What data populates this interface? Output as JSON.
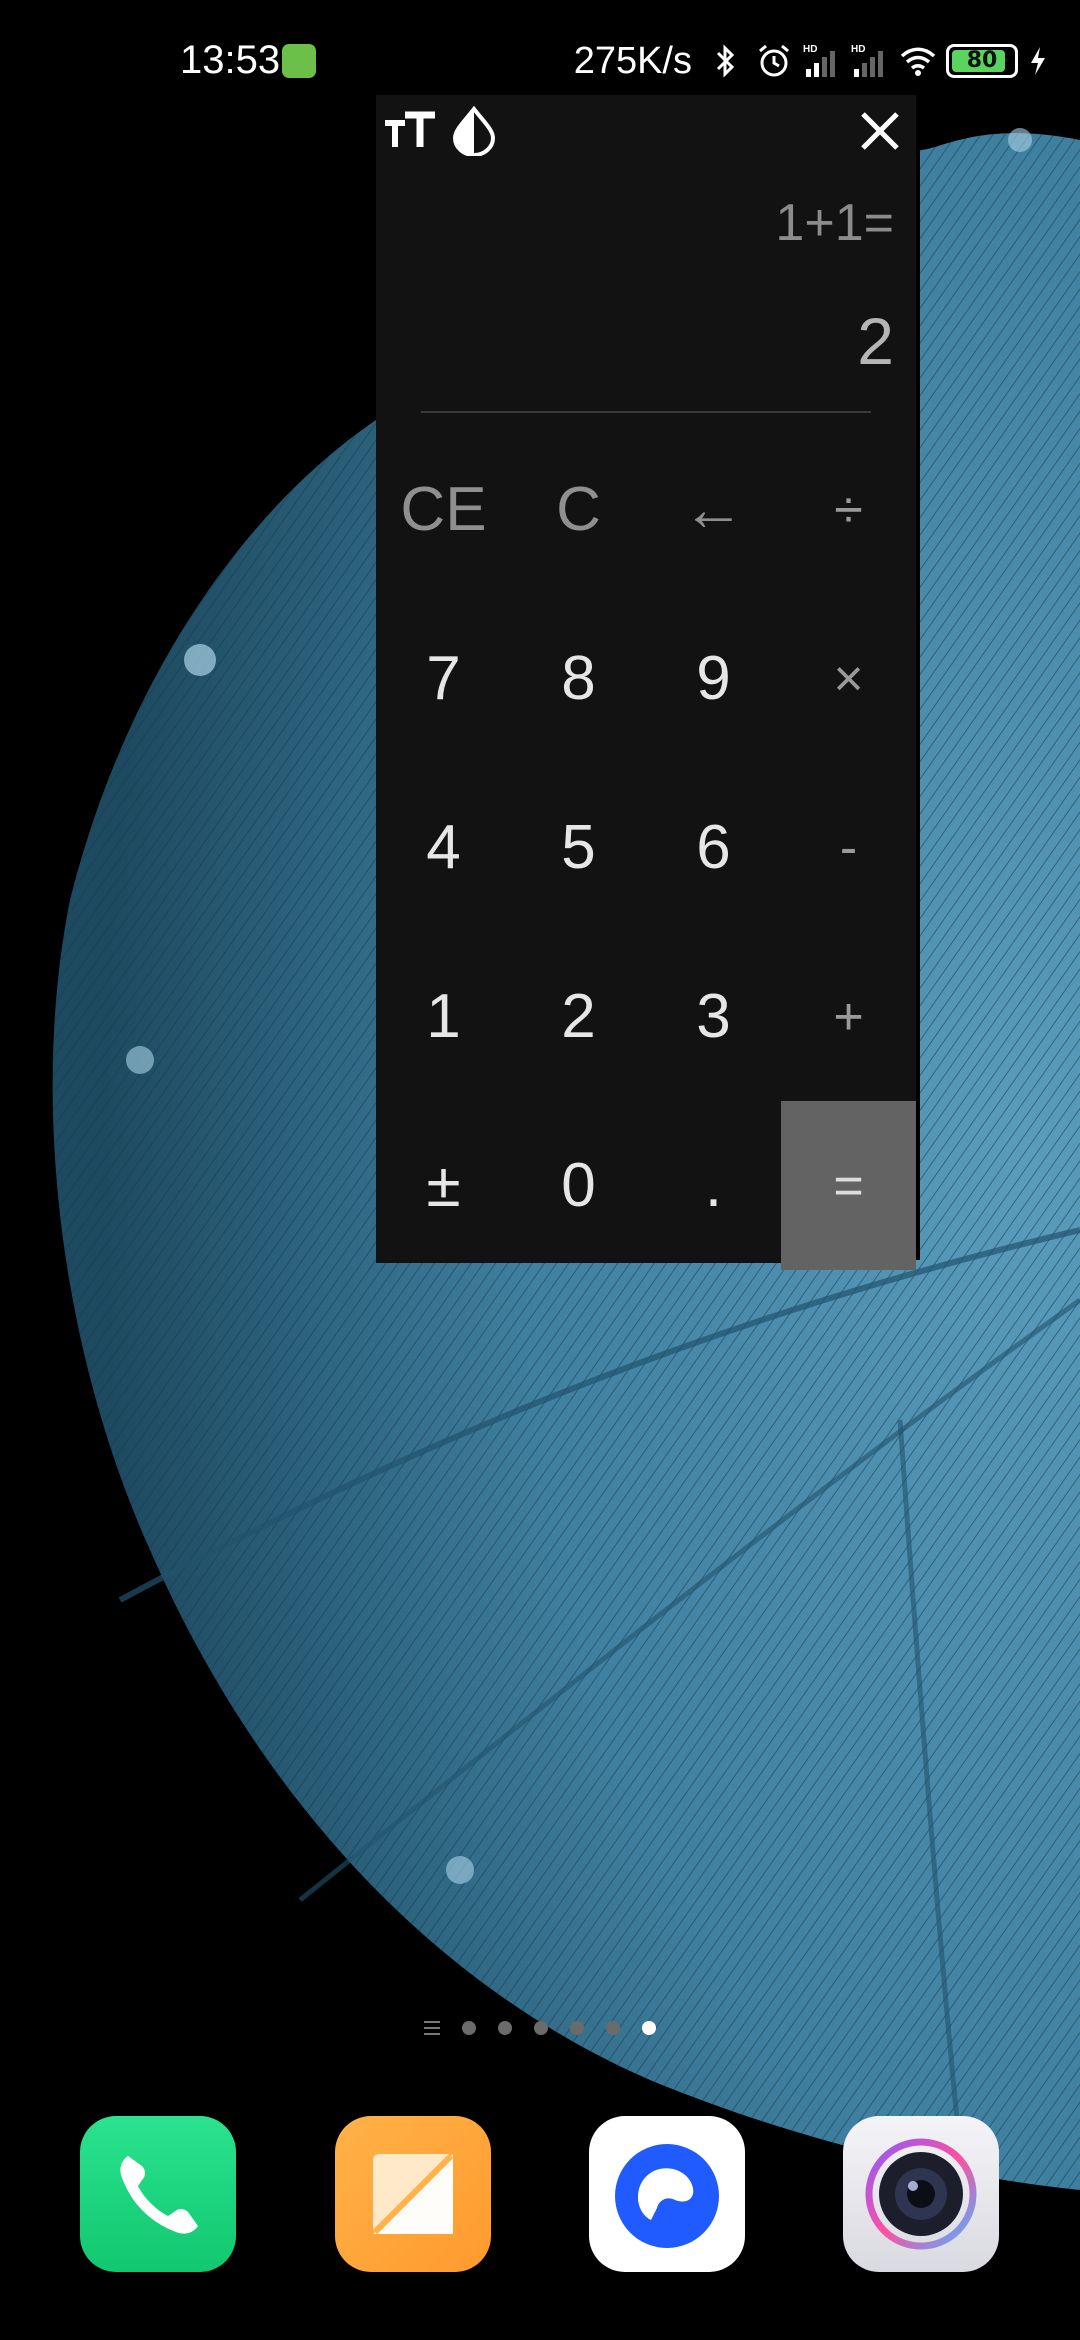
{
  "status_bar": {
    "time": "13:53",
    "net_speed": "275K/s",
    "battery": "80",
    "indicators": [
      "bluetooth-icon",
      "alarm-icon",
      "hd-signal-icon",
      "hd-signal-icon",
      "wifi-icon",
      "battery-icon",
      "charging-icon"
    ]
  },
  "calculator": {
    "expression": "1+1=",
    "result": "2",
    "toolbar": [
      "text-size-icon",
      "theme-drop-icon",
      "close-icon"
    ],
    "keys": [
      {
        "label": "CE",
        "kind": "fn",
        "name": "clear-entry-key"
      },
      {
        "label": "C",
        "kind": "fn",
        "name": "clear-key"
      },
      {
        "label": "←",
        "kind": "fn",
        "name": "backspace-key"
      },
      {
        "label": "÷",
        "kind": "op",
        "name": "divide-key"
      },
      {
        "label": "7",
        "kind": "num",
        "name": "digit-7-key"
      },
      {
        "label": "8",
        "kind": "num",
        "name": "digit-8-key"
      },
      {
        "label": "9",
        "kind": "num",
        "name": "digit-9-key"
      },
      {
        "label": "×",
        "kind": "op",
        "name": "multiply-key"
      },
      {
        "label": "4",
        "kind": "num",
        "name": "digit-4-key"
      },
      {
        "label": "5",
        "kind": "num",
        "name": "digit-5-key"
      },
      {
        "label": "6",
        "kind": "num",
        "name": "digit-6-key"
      },
      {
        "label": "-",
        "kind": "op",
        "name": "subtract-key"
      },
      {
        "label": "1",
        "kind": "num",
        "name": "digit-1-key"
      },
      {
        "label": "2",
        "kind": "num",
        "name": "digit-2-key"
      },
      {
        "label": "3",
        "kind": "num",
        "name": "digit-3-key"
      },
      {
        "label": "+",
        "kind": "op",
        "name": "add-key"
      },
      {
        "label": "±",
        "kind": "num",
        "name": "negate-key"
      },
      {
        "label": "0",
        "kind": "num",
        "name": "digit-0-key"
      },
      {
        "label": ".",
        "kind": "num",
        "name": "decimal-key"
      },
      {
        "label": "=",
        "kind": "eq",
        "name": "equals-key"
      }
    ]
  },
  "home": {
    "page_count": 6,
    "active_page": 6
  },
  "dock": [
    {
      "name": "phone-app-icon",
      "color": "#1fd882"
    },
    {
      "name": "notes-app-icon",
      "color": "#ffa53a"
    },
    {
      "name": "browser-app-icon",
      "color": "#ffffff"
    },
    {
      "name": "camera-app-icon",
      "color": "#e9e9ee"
    }
  ],
  "colors": {
    "calc_bg": "#121212",
    "equals_bg": "#636363",
    "wallpaper_blue": "#3f7f9f"
  }
}
